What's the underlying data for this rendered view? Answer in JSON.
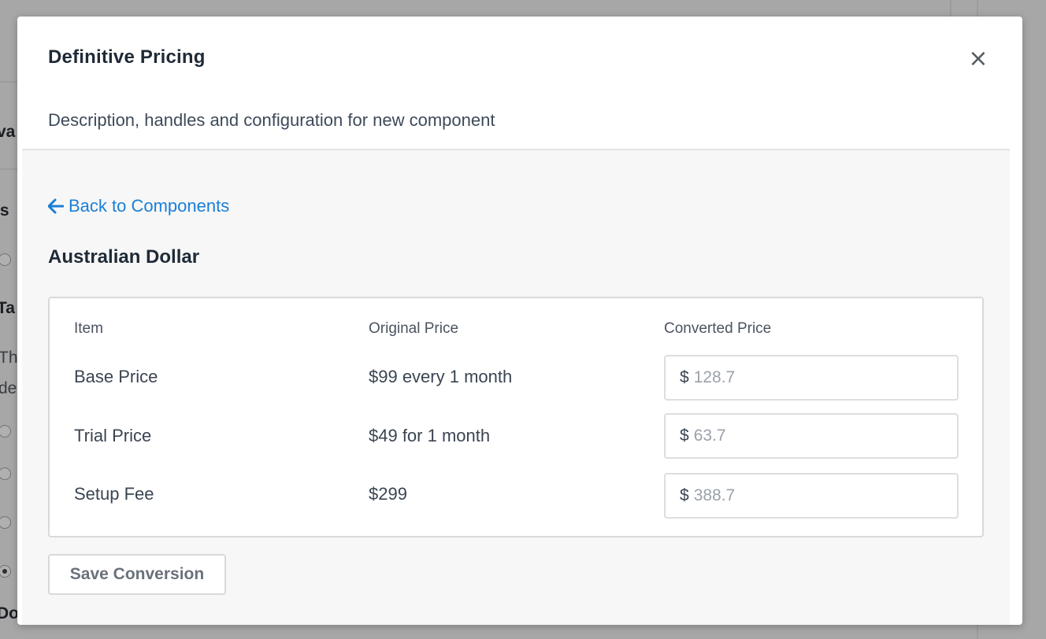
{
  "background": {
    "fragments": [
      "va",
      "ls",
      "Ta",
      "Th",
      "de",
      "Do"
    ]
  },
  "modal": {
    "title": "Definitive Pricing",
    "close_symbol": "×",
    "subtitle": "Description, handles and configuration for new component",
    "back_link": "Back to Components",
    "currency_heading": "Australian Dollar",
    "table": {
      "headers": [
        "Item",
        "Original Price",
        "Converted Price"
      ],
      "currency_prefix": "$",
      "rows": [
        {
          "item": "Base Price",
          "original": "$99 every 1 month",
          "converted_placeholder": "128.7"
        },
        {
          "item": "Trial Price",
          "original": "$49 for 1 month",
          "converted_placeholder": "63.7"
        },
        {
          "item": "Setup Fee",
          "original": "$299",
          "converted_placeholder": "388.7"
        }
      ]
    },
    "save_button": "Save Conversion"
  },
  "colors": {
    "link": "#1a7fd6",
    "backdrop": "#a7a7a8",
    "body_bg": "#f7f7f7"
  },
  "icons": {
    "back": "arrow-left-icon",
    "close": "close-icon"
  }
}
